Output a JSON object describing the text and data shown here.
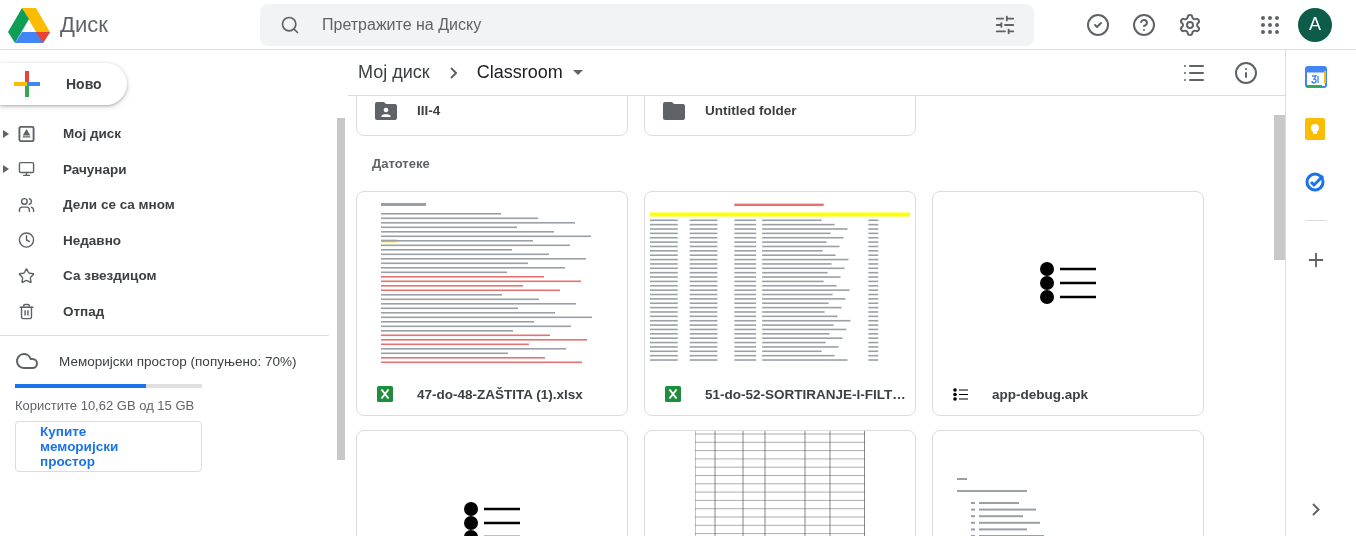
{
  "app": {
    "name": "Диск"
  },
  "search": {
    "placeholder": "Претражите на Диску"
  },
  "account": {
    "initial": "A"
  },
  "new_button": {
    "label": "Ново"
  },
  "nav": [
    {
      "label": "Мој диск",
      "expandable": true
    },
    {
      "label": "Рачунари",
      "expandable": true
    },
    {
      "label": "Дели се са мном",
      "expandable": false
    },
    {
      "label": "Недавно",
      "expandable": false
    },
    {
      "label": "Са звездицом",
      "expandable": false
    },
    {
      "label": "Отпад",
      "expandable": false
    }
  ],
  "storage": {
    "label": "Меморијски простор (попуњено: 70%)",
    "level": 0.7,
    "usage": "Користите 10,62 GB од 15 GB",
    "buy_button": "Купите меморијски простор"
  },
  "breadcrumb": [
    "Мој диск",
    "Classroom"
  ],
  "folders": [
    {
      "name": "III-4",
      "kind": "shared"
    },
    {
      "name": "Untitled folder",
      "kind": "plain"
    }
  ],
  "files_heading": "Датотеке",
  "files": [
    {
      "name": "47-do-48-ZAŠTITA (1).xlsx",
      "kind": "notes"
    },
    {
      "name": "51-do-52-SORTIRANJE-I-FILT…",
      "kind": "table"
    },
    {
      "name": "app-debug.apk",
      "kind": "apk"
    },
    {
      "kind": "apk"
    },
    {
      "kind": "grid"
    },
    {
      "kind": "list"
    }
  ]
}
